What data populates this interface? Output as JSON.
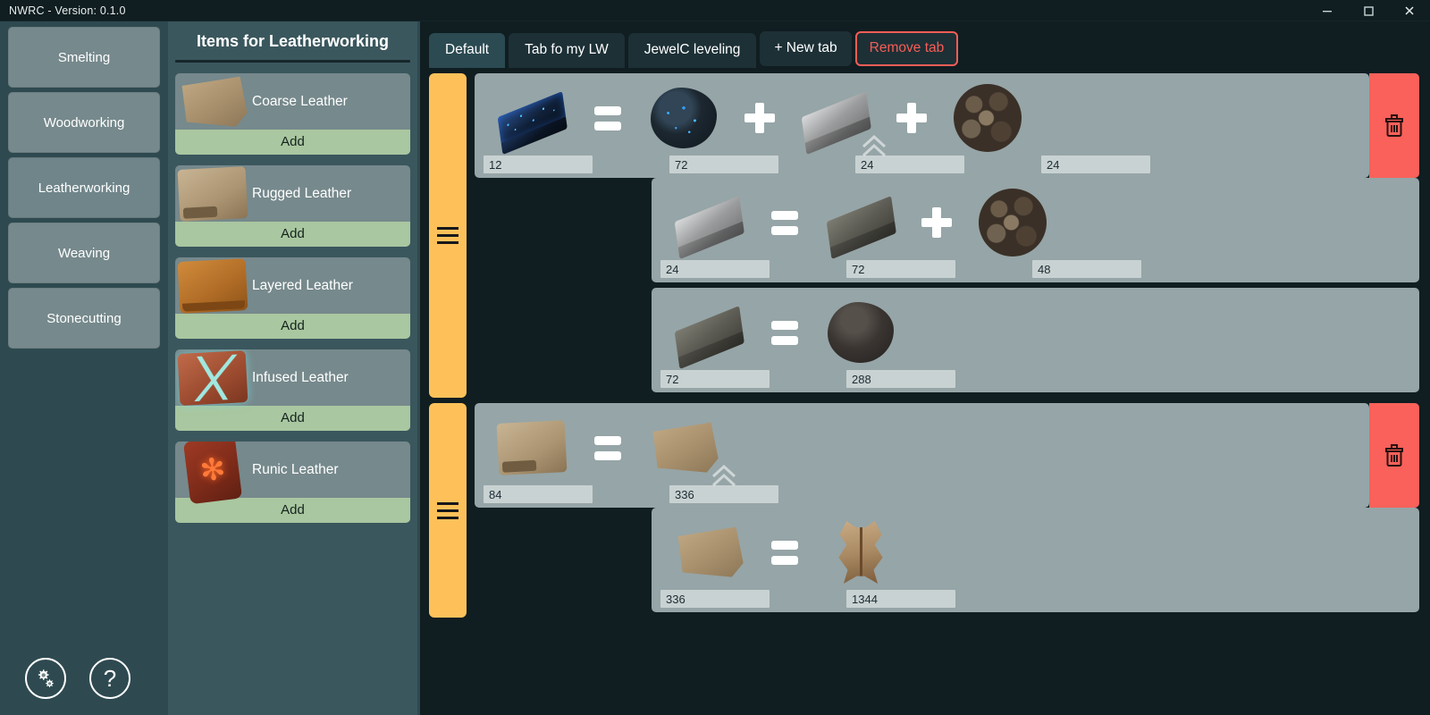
{
  "window": {
    "title": "NWRC - Version: 0.1.0",
    "controls": {
      "minimize": "minimize-icon",
      "maximize": "maximize-icon",
      "close": "close-icon"
    }
  },
  "sidebar": {
    "items": [
      {
        "label": "Smelting",
        "selected": false
      },
      {
        "label": "Woodworking",
        "selected": false
      },
      {
        "label": "Leatherworking",
        "selected": true
      },
      {
        "label": "Weaving",
        "selected": false
      },
      {
        "label": "Stonecutting",
        "selected": false
      }
    ],
    "bottom_buttons": [
      {
        "name": "settings-button",
        "icon": "gears-icon"
      },
      {
        "name": "help-button",
        "icon": "question-mark-icon"
      }
    ]
  },
  "items_panel": {
    "title": "Items for Leatherworking",
    "add_label": "Add",
    "items": [
      {
        "label": "Coarse Leather",
        "icon": "coarse-leather-icon"
      },
      {
        "label": "Rugged Leather",
        "icon": "rugged-leather-icon"
      },
      {
        "label": "Layered Leather",
        "icon": "layered-leather-icon"
      },
      {
        "label": "Infused Leather",
        "icon": "infused-leather-icon"
      },
      {
        "label": "Runic Leather",
        "icon": "runic-leather-icon"
      }
    ]
  },
  "tabs": {
    "list": [
      {
        "label": "Default",
        "active": true
      },
      {
        "label": "Tab fo my LW",
        "active": false
      },
      {
        "label": "JewelC leveling",
        "active": false
      }
    ],
    "new_tab_label": "+ New tab",
    "remove_tab_label": "Remove tab"
  },
  "recipes": {
    "groups": [
      {
        "handle": "drag-handle",
        "delete": "delete-recipe-button",
        "main_row": {
          "slots": [
            {
              "value": "12",
              "icon": "starmetal-ingot-icon"
            },
            {
              "op": "equals"
            },
            {
              "value": "72",
              "icon": "starmetal-ore-icon"
            },
            {
              "op": "plus"
            },
            {
              "value": "24",
              "icon": "steel-ingot-icon",
              "collapse": true
            },
            {
              "op": "plus"
            },
            {
              "value": "24",
              "icon": "charcoal-icon"
            }
          ]
        },
        "sub_rows": [
          {
            "slots": [
              {
                "value": "24",
                "icon": "steel-ingot-icon"
              },
              {
                "op": "equals"
              },
              {
                "value": "72",
                "icon": "iron-ingot-icon"
              },
              {
                "op": "plus"
              },
              {
                "value": "48",
                "icon": "charcoal-icon"
              }
            ]
          },
          {
            "slots": [
              {
                "value": "72",
                "icon": "iron-ingot-icon"
              },
              {
                "op": "equals"
              },
              {
                "value": "288",
                "icon": "iron-ore-icon"
              }
            ]
          }
        ]
      },
      {
        "handle": "drag-handle",
        "delete": "delete-recipe-button",
        "main_row": {
          "slots": [
            {
              "value": "84",
              "icon": "rugged-leather-icon"
            },
            {
              "op": "equals"
            },
            {
              "value": "336",
              "icon": "coarse-leather-icon",
              "collapse": true
            }
          ]
        },
        "sub_rows": [
          {
            "slots": [
              {
                "value": "336",
                "icon": "coarse-leather-icon"
              },
              {
                "op": "equals"
              },
              {
                "value": "1344",
                "icon": "rawhide-icon"
              }
            ]
          }
        ]
      }
    ]
  },
  "colors": {
    "titlebar": "#101d21",
    "sidebar_bg": "#2e4a50",
    "nav_button": "#76898c",
    "items_panel_bg": "#3a575d",
    "add_button": "#a9c7a0",
    "content_bg": "#101d21",
    "tab_active": "#2b4a52",
    "tab_inactive": "#1c3036",
    "danger": "#f75d56",
    "row_bg": "#96a5a7",
    "drag_handle": "#fec15a",
    "delete_bg": "#f9615a",
    "input_bg": "#c9d2d2"
  }
}
